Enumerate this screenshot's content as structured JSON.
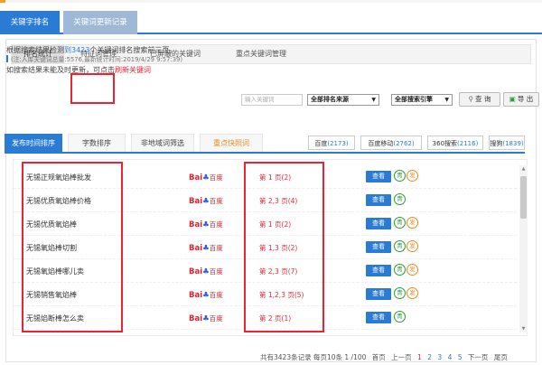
{
  "top_tabs": [
    {
      "label": "关键字排名",
      "active": true
    },
    {
      "label": "关键词更新记录",
      "active": false
    }
  ],
  "sub_tabs": [
    {
      "label": "排名统计",
      "active": true
    },
    {
      "label": "特征词管理",
      "active": false
    },
    {
      "label": "已屏蔽的关键词",
      "active": false
    },
    {
      "label": "重点关键词管理",
      "active": false
    }
  ],
  "info": {
    "line1_prefix": "根据搜索结果检测",
    "line1_link": "到3423",
    "line1_suffix": "个关键词排名搜索前三页。",
    "note": "(注:入库关键词总量:5576,最新统计时间:2019/4/29 9:57:39)",
    "line3_prefix": "如搜索结果未能及时更新，可点击",
    "line3_link": "刷新关键词"
  },
  "filters": {
    "keyword_placeholder": "输入关键词",
    "source_select": "全部排名来源",
    "engine_select": "全部搜索引擎",
    "search_button": "查 询",
    "export_button": "导 出",
    "search_icon": "search-icon",
    "export_icon": "export-icon"
  },
  "filter_tabs": [
    {
      "label": "发布时间排序",
      "active": true
    },
    {
      "label": "字数排序",
      "active": false
    },
    {
      "label": "非地域词筛选",
      "active": false
    },
    {
      "label": "重点快照词",
      "active": false,
      "highlight": true
    }
  ],
  "engine_tabs": [
    {
      "name": "百度",
      "count": "(2173)"
    },
    {
      "name": "百度移动",
      "count": "(2762)"
    },
    {
      "name": "360搜索",
      "count": "(2116)"
    },
    {
      "name": "搜狗",
      "count": "(1839)"
    }
  ],
  "rows": [
    {
      "keyword": "无锡正规氧焰棒批发",
      "rank": "第 1 页(2)"
    },
    {
      "keyword": "无锡优质氧焰棒价格",
      "rank": "第 2,3 页(4)"
    },
    {
      "keyword": "无锡优质氧焰棒",
      "rank": "第 1 页(2)"
    },
    {
      "keyword": "无锡氧焰棒切割",
      "rank": "第 1,3 页(2)"
    },
    {
      "keyword": "无锡氧焰棒哪儿卖",
      "rank": "第 2,3 页(7)"
    },
    {
      "keyword": "无锡销售氧焰棒",
      "rank": "第 1,2,3 页(5)"
    },
    {
      "keyword": "无锡焰断棒怎么卖",
      "rank": "第 2 页(1)"
    }
  ],
  "row_actions": {
    "logo_prefix": "Bai",
    "logo_suffix": "百度",
    "view_label": "查看",
    "green_label": "青",
    "orange_label": "发"
  },
  "pager": {
    "summary": "共有3423条记录 每页10条 1 /100",
    "first": "首页",
    "prev": "上一页",
    "pages": [
      "1",
      "2",
      "3",
      "4",
      "5"
    ],
    "current": "1",
    "next": "下一页",
    "last": "尾页"
  },
  "colors": {
    "accent": "#2a7bd4",
    "highlight_red": "#e22233",
    "orange": "#f08a1a",
    "green": "#2a9d3a"
  }
}
